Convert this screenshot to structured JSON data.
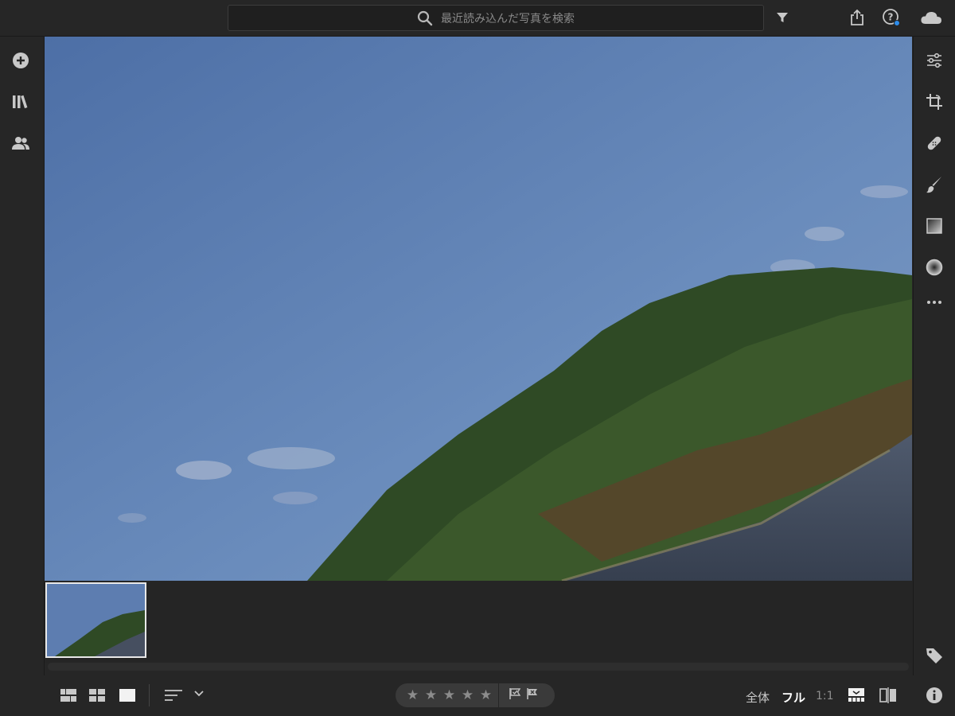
{
  "search": {
    "placeholder": "最近読み込んだ写真を検索"
  },
  "topbar": {
    "icons": [
      "filter-icon",
      "share-icon",
      "help-icon",
      "cloud-icon"
    ]
  },
  "leftbar": {
    "icons": [
      "add-photo-icon",
      "library-icon",
      "people-icon"
    ]
  },
  "rightbar": {
    "icons": [
      "edit-sliders-icon",
      "crop-icon",
      "healing-icon",
      "brush-icon",
      "linear-gradient-icon",
      "radial-gradient-icon",
      "more-icon",
      "tag-icon",
      "info-icon"
    ]
  },
  "bottombar": {
    "view_modes": [
      "square-grid-icon",
      "grid-icon",
      "single-view-icon"
    ],
    "sort_icon": "sort-icon",
    "stars": [
      "★",
      "★",
      "★",
      "★",
      "★"
    ],
    "flags": [
      "pick-flag-icon",
      "reject-flag-icon"
    ],
    "zoom": {
      "fit": "全体",
      "fill": "フル",
      "one_to_one": "1:1"
    },
    "tools": [
      "filmstrip-toggle-icon",
      "compare-icon"
    ]
  },
  "colors": {
    "background": "#262626",
    "accent_dot": "#2d8ceb",
    "selection_border": "#e8e8e8"
  }
}
